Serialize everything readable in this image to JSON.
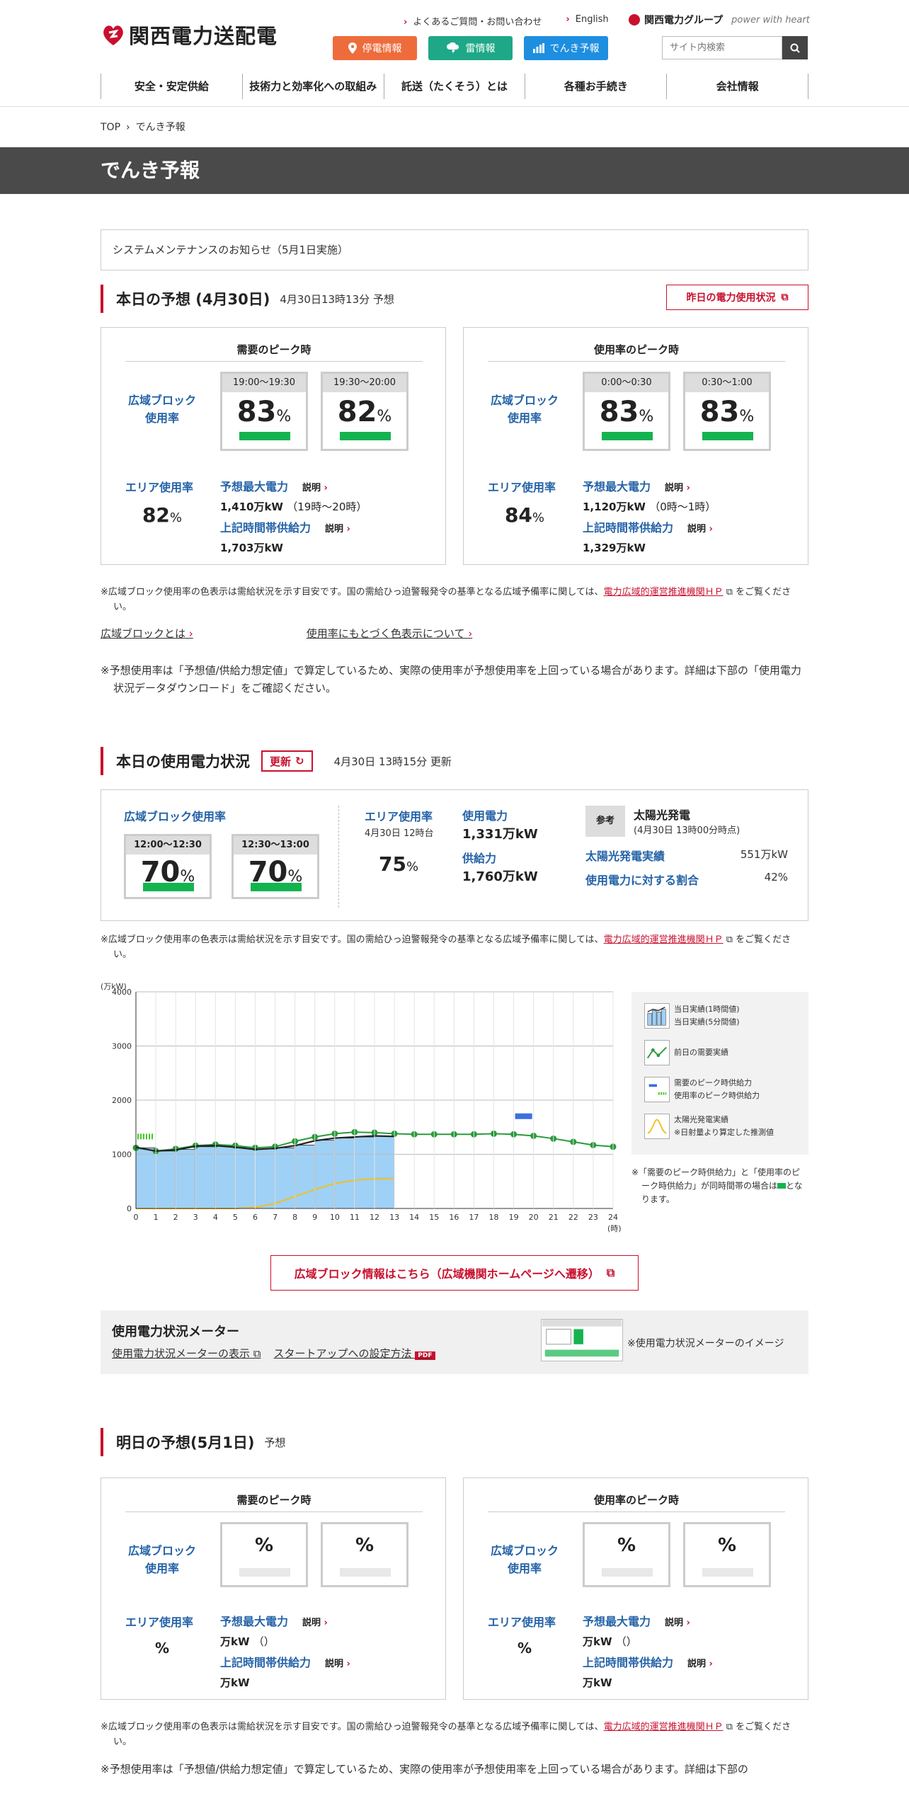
{
  "header": {
    "site_name": "関西電力送配電",
    "faq_link": "よくあるご質問・お問い合わせ",
    "english_link": "English",
    "group_name": "関西電力グループ",
    "group_tagline": "power with heart",
    "quick_buttons": [
      {
        "label": "停電情報",
        "color": "#ee6c3c"
      },
      {
        "label": "雷情報",
        "color": "#1ea888"
      },
      {
        "label": "でんき予報",
        "color": "#1e8ee0"
      }
    ],
    "search_placeholder": "サイト内検索",
    "nav": [
      "安全・安定供給",
      "技術力と効率化への取組み",
      "託送（たくそう）とは",
      "各種お手続き",
      "会社情報"
    ]
  },
  "breadcrumb": {
    "home": "TOP",
    "current": "でんき予報"
  },
  "page_title": "でんき予報",
  "notice": "システムメンテナンスのお知らせ（5月1日実施）",
  "today_forecast": {
    "title": "本日の予想 (4月30日)",
    "subtitle": "4月30日13時13分 予想",
    "yesterday_button": "昨日の電力使用状況",
    "cards": [
      {
        "title": "需要のピーク時",
        "block_label_1": "広域ブロック",
        "block_label_2": "使用率",
        "slots": [
          {
            "time": "19:00〜19:30",
            "value": "83",
            "unit": "%"
          },
          {
            "time": "19:30〜20:00",
            "value": "82",
            "unit": "%"
          }
        ],
        "area_label": "エリア使用率",
        "area_value": "82",
        "area_unit": "%",
        "max_label": "予想最大電力",
        "explain": "説明",
        "max_value": "1,410万kW",
        "max_time": "（19時〜20時）",
        "supply_label": "上記時間帯供給力",
        "supply_value": "1,703万kW"
      },
      {
        "title": "使用率のピーク時",
        "block_label_1": "広域ブロック",
        "block_label_2": "使用率",
        "slots": [
          {
            "time": "0:00〜0:30",
            "value": "83",
            "unit": "%"
          },
          {
            "time": "0:30〜1:00",
            "value": "83",
            "unit": "%"
          }
        ],
        "area_label": "エリア使用率",
        "area_value": "84",
        "area_unit": "%",
        "max_label": "予想最大電力",
        "explain": "説明",
        "max_value": "1,120万kW",
        "max_time": "（0時〜1時）",
        "supply_label": "上記時間帯供給力",
        "supply_value": "1,329万kW"
      }
    ],
    "note_1a": "※広域ブロック使用率の色表示は需給状況を示す目安です。国の需給ひっ迫警報発令の基準となる広域予備率に関しては、",
    "note_link": "電力広域的運営推進機関ＨＰ",
    "note_1b": "をご覧ください。",
    "link_1": "広域ブロックとは",
    "link_2": "使用率にもとづく色表示について",
    "note_2": "※予想使用率は「予想値/供給力想定値」で算定しているため、実際の使用率が予想使用率を上回っている場合があります。詳細は下部の「使用電力状況データダウンロード」をご確認ください。"
  },
  "today_usage": {
    "title": "本日の使用電力状況",
    "update_button": "更新",
    "updated": "4月30日 13時15分 更新",
    "block_title": "広域ブロック使用率",
    "slots": [
      {
        "time": "12:00〜12:30",
        "value": "70",
        "unit": "%"
      },
      {
        "time": "12:30〜13:00",
        "value": "70",
        "unit": "%"
      }
    ],
    "area_label": "エリア使用率",
    "area_time": "4月30日 12時台",
    "area_value": "75",
    "area_unit": "%",
    "usage_label": "使用電力",
    "usage_value": "1,331万kW",
    "supply_label": "供給力",
    "supply_value": "1,760万kW",
    "ref_label": "参考",
    "solar_title": "太陽光発電",
    "solar_date": "(4月30日 13時00分時点)",
    "solar_actual_label": "太陽光発電実績",
    "solar_actual_value": "551万kW",
    "solar_ratio_label": "使用電力に対する割合",
    "solar_ratio_value": "42%",
    "note_a": "※広域ブロック使用率の色表示は需給状況を示す目安です。国の需給ひっ迫警報発令の基準となる広域予備率に関しては、",
    "note_link": "電力広域的運営推進機関ＨＰ",
    "note_b": "をご覧ください。"
  },
  "chart_legend": {
    "l1a": "当日実績(1時間値)",
    "l1b": "当日実績(5分間値)",
    "l2": "前日の需要実績",
    "l3a": "需要のピーク時供給力",
    "l3b": "使用率のピーク時供給力",
    "l4a": "太陽光発電実績",
    "l4b": "※日射量より算定した推測値",
    "note": "※「需要のピーク時供給力」と「使用率のピーク時供給力」が同時間帯の場合は",
    "note_end": "となります。"
  },
  "chart_data": {
    "type": "bar",
    "ylabel": "(万kW)",
    "xlabel": "(時)",
    "ylim": [
      0,
      4000
    ],
    "yticks": [
      0,
      1000,
      2000,
      3000,
      4000
    ],
    "x": [
      0,
      1,
      2,
      3,
      4,
      5,
      6,
      7,
      8,
      9,
      10,
      11,
      12,
      13,
      14,
      15,
      16,
      17,
      18,
      19,
      20,
      21,
      22,
      23,
      24
    ],
    "series": [
      {
        "name": "当日実績(1時間値)",
        "type": "bar",
        "values": [
          1120,
          1060,
          1090,
          1140,
          1160,
          1130,
          1100,
          1120,
          1170,
          1260,
          1300,
          1320,
          1331
        ]
      },
      {
        "name": "当日実績(5分間値)",
        "type": "line",
        "values": [
          1130,
          1060,
          1080,
          1150,
          1160,
          1130,
          1090,
          1110,
          1160,
          1250,
          1300,
          1320,
          1340,
          1330
        ]
      },
      {
        "name": "前日の需要実績",
        "type": "line",
        "values": [
          1120,
          1060,
          1100,
          1160,
          1180,
          1160,
          1120,
          1140,
          1240,
          1320,
          1380,
          1410,
          1400,
          1380,
          1370,
          1370,
          1370,
          1370,
          1380,
          1370,
          1340,
          1290,
          1230,
          1170,
          1140
        ]
      },
      {
        "name": "需要のピーク時供給力",
        "type": "marker",
        "x_range": [
          19,
          20
        ],
        "value": 1703
      },
      {
        "name": "使用率のピーク時供給力",
        "type": "marker",
        "x_range": [
          0,
          1
        ],
        "value": 1329
      },
      {
        "name": "太陽光発電実績",
        "type": "line",
        "values": [
          0,
          0,
          0,
          0,
          0,
          0,
          20,
          90,
          220,
          350,
          460,
          520,
          551,
          551
        ]
      }
    ]
  },
  "wide_area_button": "広域ブロック情報はこちら（広域機関ホームページへ遷移）",
  "meter": {
    "title": "使用電力状況メーター",
    "link_1": "使用電力状況メーターの表示",
    "link_2": "スタートアップへの設定方法",
    "pdf": "PDF",
    "caption": "※使用電力状況メーターのイメージ"
  },
  "tomorrow_forecast": {
    "title": "明日の予想(5月1日)",
    "subtitle": "予想",
    "cards": [
      {
        "title": "需要のピーク時",
        "block_label_1": "広域ブロック",
        "block_label_2": "使用率",
        "slots": [
          {
            "time": "",
            "value": "",
            "unit": "%"
          },
          {
            "time": "",
            "value": "",
            "unit": "%"
          }
        ],
        "area_label": "エリア使用率",
        "area_value": "",
        "area_unit": "%",
        "max_label": "予想最大電力",
        "explain": "説明",
        "max_value": "万kW",
        "max_time": "（）",
        "supply_label": "上記時間帯供給力",
        "supply_value": "万kW"
      },
      {
        "title": "使用率のピーク時",
        "block_label_1": "広域ブロック",
        "block_label_2": "使用率",
        "slots": [
          {
            "time": "",
            "value": "",
            "unit": "%"
          },
          {
            "time": "",
            "value": "",
            "unit": "%"
          }
        ],
        "area_label": "エリア使用率",
        "area_value": "",
        "area_unit": "%",
        "max_label": "予想最大電力",
        "explain": "説明",
        "max_value": "万kW",
        "max_time": "（）",
        "supply_label": "上記時間帯供給力",
        "supply_value": "万kW"
      }
    ],
    "note_a": "※広域ブロック使用率の色表示は需給状況を示す目安です。国の需給ひっ迫警報発令の基準となる広域予備率に関しては、",
    "note_link": "電力広域的運営推進機関ＨＰ",
    "note_b": "をご覧ください。",
    "note_2": "※予想使用率は「予想値/供給力想定値」で算定しているため、実際の使用率が予想使用率を上回っている場合があります。詳細は下部の"
  }
}
